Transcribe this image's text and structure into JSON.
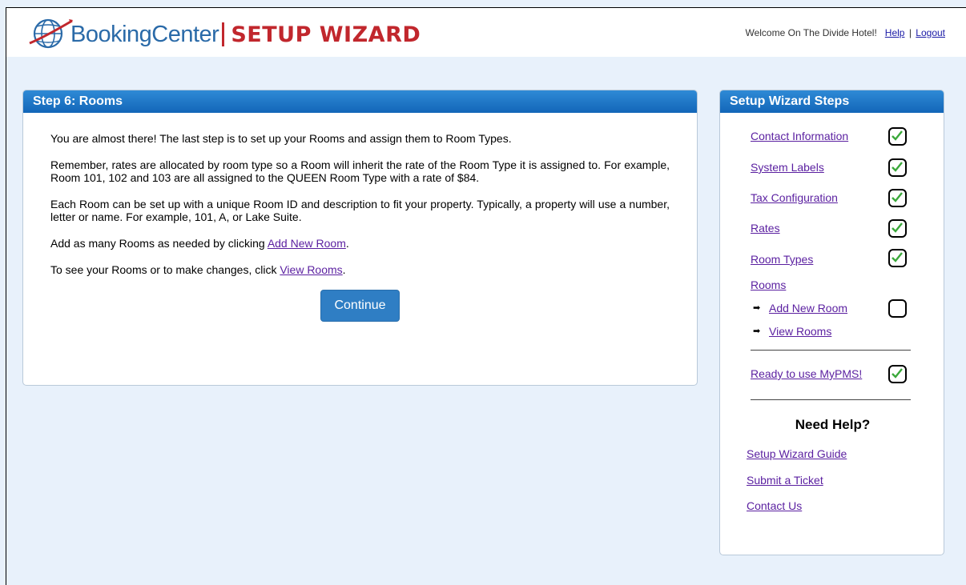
{
  "header": {
    "logo_text_1": "BookingCenter",
    "logo_text_2": "SETUP WIZARD",
    "welcome": "Welcome  On The Divide Hotel!",
    "help": "Help",
    "separator": "|",
    "logout": "Logout"
  },
  "main": {
    "title": "Step 6: Rooms",
    "p1": "You are almost there! The last step is to set up your Rooms and assign them to Room Types.",
    "p2": "Remember, rates are allocated by room type so a Room will inherit the rate of the Room Type it is assigned to. For example, Room 101, 102 and 103 are all assigned to the QUEEN Room Type with a rate of $84.",
    "p3": "Each Room can be set up with a unique Room ID and description to fit your property. Typically, a property will use a number, letter or name. For example, 101, A, or Lake Suite.",
    "p4_pre": "Add as many Rooms as needed by clicking ",
    "p4_link": "Add New Room",
    "p4_post": ".",
    "p5_pre": "To see your Rooms or to make changes, click ",
    "p5_link": "View Rooms",
    "p5_post": ".",
    "continue_label": "Continue"
  },
  "sidebar": {
    "title": "Setup Wizard Steps",
    "steps": [
      {
        "label": "Contact Information",
        "checked": true
      },
      {
        "label": "System Labels",
        "checked": true
      },
      {
        "label": "Tax Configuration",
        "checked": true
      },
      {
        "label": "Rates",
        "checked": true
      },
      {
        "label": "Room Types",
        "checked": true
      },
      {
        "label": "Rooms"
      },
      {
        "label": "Add New Room",
        "checked": false
      },
      {
        "label": "View Rooms"
      },
      {
        "label": "Ready to use MyPMS!",
        "checked": true
      }
    ],
    "need_help": "Need Help?",
    "help_links": [
      "Setup Wizard Guide",
      "Submit a Ticket",
      "Contact Us"
    ]
  },
  "colors": {
    "header_blue": "#1366b8",
    "brand_red": "#c1272d",
    "brand_blue": "#2a6aa8",
    "link_purple": "#5a1fa0",
    "check_green": "#3aa83a",
    "button_blue": "#2f7ec4"
  },
  "icons": [
    "globe-logo-icon",
    "check-icon",
    "arrow-right-icon"
  ]
}
